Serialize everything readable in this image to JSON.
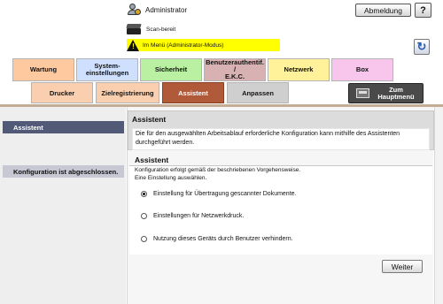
{
  "header": {
    "user_label": "Administrator",
    "logout_label": "Abmeldung",
    "help_label": "?",
    "status_label": "Scan-bereit",
    "mode_label": "Im Menü (Administrator-Modus)",
    "refresh_icon": "↻"
  },
  "tabs_main": [
    {
      "label": "Wartung"
    },
    {
      "label": "System-\neinstellungen"
    },
    {
      "label": "Sicherheit"
    },
    {
      "label": "Benutzerauthentif. /\nE.K.C."
    },
    {
      "label": "Netzwerk"
    },
    {
      "label": "Box"
    }
  ],
  "tabs_sub": [
    {
      "label": "Drucker"
    },
    {
      "label": "Zielregistrierung"
    },
    {
      "label": "Assistent",
      "active": true
    },
    {
      "label": "Anpassen"
    }
  ],
  "main_menu_label": "Zum\nHauptmenü",
  "sidebar": {
    "items": [
      {
        "label": "Assistent",
        "active": true
      },
      {
        "label": "Konfiguration ist abgeschlossen."
      }
    ]
  },
  "content": {
    "title": "Assistent",
    "description": "Die für den ausgewählten Arbeitsablauf erforderliche Konfiguration kann mithilfe des Assistenten durchgeführt werden.",
    "section_title": "Assistent",
    "section_desc_line1": "Konfiguration erfolgt gemäß der beschriebenen Vorgehensweise.",
    "section_desc_line2": "Eine Einstellung auswählen.",
    "options": [
      {
        "label": "Einstellung für Übertragung gescannter Dokumente.",
        "selected": true
      },
      {
        "label": "Einstellungen für Netzwerkdruck.",
        "selected": false
      },
      {
        "label": "Nutzung dieses Geräts durch Benutzer verhindern.",
        "selected": false
      }
    ],
    "next_label": "Weiter"
  }
}
